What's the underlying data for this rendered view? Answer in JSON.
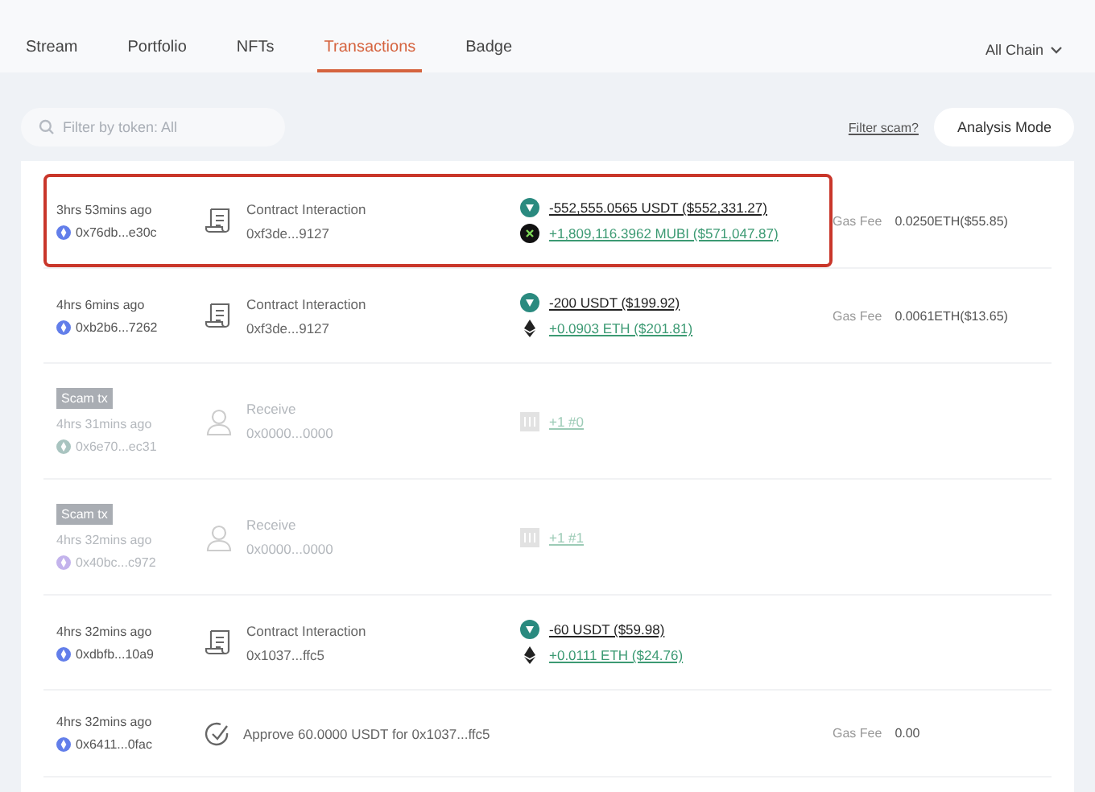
{
  "tabs": [
    {
      "label": "Stream",
      "selected": false
    },
    {
      "label": "Portfolio",
      "selected": false
    },
    {
      "label": "NFTs",
      "selected": false
    },
    {
      "label": "Transactions",
      "selected": true
    },
    {
      "label": "Badge",
      "selected": false
    }
  ],
  "chain_select": "All Chain",
  "filter": {
    "placeholder": "Filter by token: All"
  },
  "filter_scam_link": "Filter scam?",
  "analysis_button": "Analysis Mode",
  "rows": [
    {
      "highlighted": true,
      "scam": false,
      "time": "3hrs 53mins ago",
      "address": "0x76db...e30c",
      "color": "#627eea",
      "kind": "contract",
      "action": "Contract Interaction",
      "target": "0xf3de...9127",
      "tokens": [
        {
          "kind": "usdt",
          "incoming": false,
          "text": "-552,555.0565 USDT ($552,331.27)"
        },
        {
          "kind": "mubi",
          "incoming": true,
          "text": "+1,809,116.3962 MUBI ($571,047.87)"
        }
      ],
      "gas_label": "Gas Fee",
      "gas": "0.0250ETH($55.85)"
    },
    {
      "highlighted": false,
      "scam": false,
      "time": "4hrs 6mins ago",
      "address": "0xb2b6...7262",
      "color": "#627eea",
      "kind": "contract",
      "action": "Contract Interaction",
      "target": "0xf3de...9127",
      "tokens": [
        {
          "kind": "usdt",
          "incoming": false,
          "text": "-200 USDT ($199.92)"
        },
        {
          "kind": "eth",
          "incoming": true,
          "text": "+0.0903 ETH ($201.81)"
        }
      ],
      "gas_label": "Gas Fee",
      "gas": "0.0061ETH($13.65)"
    },
    {
      "highlighted": false,
      "scam": true,
      "scam_label": "Scam tx",
      "time": "4hrs 31mins ago",
      "address": "0x6e70...ec31",
      "color": "#a9c4c0",
      "kind": "receive",
      "action": "Receive",
      "target": "0x0000...0000",
      "tokens": [
        {
          "kind": "nft",
          "incoming": true,
          "text": "+1 #0"
        }
      ]
    },
    {
      "highlighted": false,
      "scam": true,
      "scam_label": "Scam tx",
      "time": "4hrs 32mins ago",
      "address": "0x40bc...c972",
      "color": "#c3b3ec",
      "kind": "receive",
      "action": "Receive",
      "target": "0x0000...0000",
      "tokens": [
        {
          "kind": "nft",
          "incoming": true,
          "text": "+1 #1"
        }
      ]
    },
    {
      "highlighted": false,
      "scam": false,
      "time": "4hrs 32mins ago",
      "address": "0xdbfb...10a9",
      "color": "#627eea",
      "kind": "contract",
      "action": "Contract Interaction",
      "target": "0x1037...ffc5",
      "tokens": [
        {
          "kind": "usdt",
          "incoming": false,
          "text": "-60 USDT ($59.98)"
        },
        {
          "kind": "eth",
          "incoming": true,
          "text": "+0.0111 ETH ($24.76)"
        }
      ]
    },
    {
      "highlighted": false,
      "scam": false,
      "time": "4hrs 32mins ago",
      "address": "0x6411...0fac",
      "color": "#627eea",
      "kind": "approve",
      "action": "Approve 60.0000 USDT for 0x1037...ffc5",
      "tokens": [],
      "gas_label": "Gas Fee",
      "gas": "0.00"
    }
  ]
}
